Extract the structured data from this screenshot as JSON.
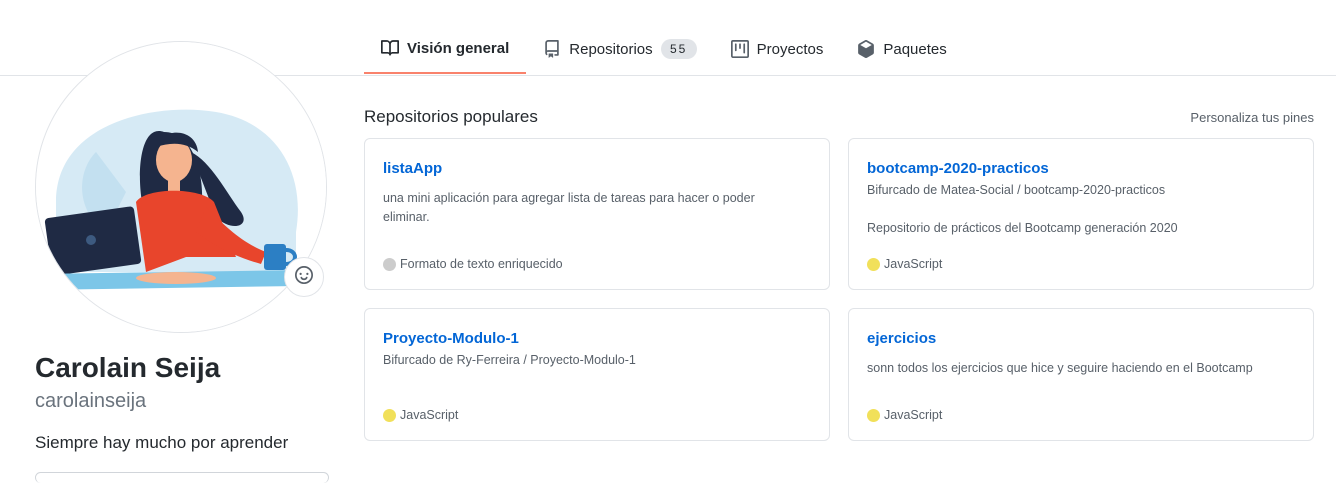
{
  "tabs": [
    {
      "label": "Visión general",
      "icon": "book-icon",
      "active": true
    },
    {
      "label": "Repositorios",
      "icon": "repo-icon",
      "count": "55"
    },
    {
      "label": "Proyectos",
      "icon": "project-icon"
    },
    {
      "label": "Paquetes",
      "icon": "package-icon"
    }
  ],
  "profile": {
    "name": "Carolain Seija",
    "login": "carolainseija",
    "bio": "Siempre hay mucho por aprender"
  },
  "pinned": {
    "title": "Repositorios populares",
    "customize": "Personaliza tus pines",
    "repos": [
      {
        "name": "listaApp",
        "description": "una mini aplicación para agregar lista de tareas para hacer o poder eliminar.",
        "language": "Formato de texto enriquecido",
        "language_color": "#cccccc"
      },
      {
        "name": "bootcamp-2020-practicos",
        "fork": "Bifurcado de Matea-Social / bootcamp-2020-practicos",
        "description": "Repositorio de prácticos del Bootcamp generación 2020",
        "language": "JavaScript",
        "language_color": "#f1e05a"
      },
      {
        "name": "Proyecto-Modulo-1",
        "fork": "Bifurcado de Ry-Ferreira / Proyecto-Modulo-1",
        "language": "JavaScript",
        "language_color": "#f1e05a"
      },
      {
        "name": "ejercicios",
        "description": "sonn todos los ejercicios que hice y seguire haciendo en el Bootcamp",
        "language": "JavaScript",
        "language_color": "#f1e05a"
      }
    ]
  },
  "colors": {
    "accent": "#f9826c",
    "link": "#0366d6",
    "muted": "#586069"
  }
}
